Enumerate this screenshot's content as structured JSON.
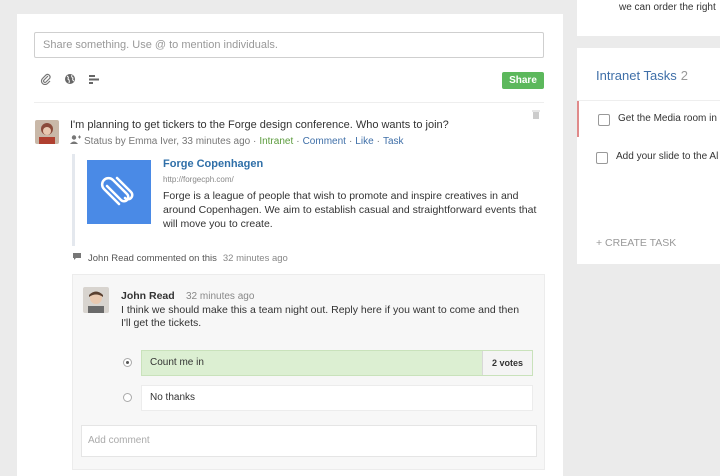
{
  "share": {
    "placeholder": "Share something. Use @ to mention individuals.",
    "button_label": "Share",
    "tools": [
      "paperclip-icon",
      "globe-icon",
      "poll-icon"
    ]
  },
  "post": {
    "text": "I'm planning to get tickers to the Forge design conference. Who wants to join?",
    "meta_prefix": "Status by Emma Iver, 33 minutes ago ·",
    "meta_group": "Intranet",
    "meta_comment": "Comment",
    "meta_like": "Like",
    "meta_task": "Task",
    "meta_separator": "·"
  },
  "link_preview": {
    "title": "Forge Copenhagen",
    "url": "http://forgecph.com/",
    "description": "Forge is a league of people that wish to promote and inspire creatives in and around Copenhagen. We aim to establish casual and straightforward events that will move you to create."
  },
  "comment_activity": {
    "text": "John Read commented on this",
    "time": "32 minutes ago"
  },
  "comment": {
    "author": "John Read",
    "time": "32 minutes ago",
    "body": "I think we should make this a team night out. Reply here if you want to come and then I'll get the tickets.",
    "poll": [
      {
        "label": "Count me in",
        "votes": "2 votes",
        "selected": true
      },
      {
        "label": "No thanks",
        "votes": "",
        "selected": false
      }
    ],
    "add_placeholder": "Add comment"
  },
  "top_card": {
    "text": "we can order the right"
  },
  "tasks": {
    "title": "Intranet Tasks",
    "count": "2",
    "items": [
      {
        "label": "Get the Media room in"
      },
      {
        "label": "Add your slide to the Al"
      }
    ],
    "create_label": "+ CREATE TASK"
  },
  "colors": {
    "accent": "#3f6fa8",
    "share_button": "#5cb85c",
    "poll_winner": "#dcefd2",
    "preview_thumb": "#4a8ae6"
  }
}
